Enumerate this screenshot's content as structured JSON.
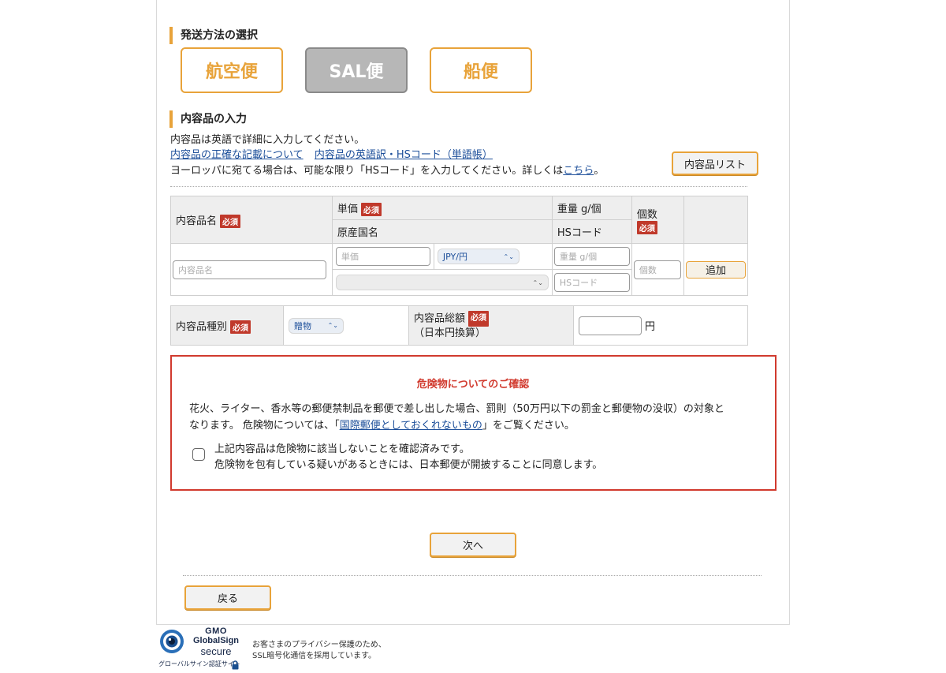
{
  "shipping": {
    "title": "発送方法の選択",
    "options": [
      {
        "label": "航空便",
        "state": "selectable"
      },
      {
        "label": "SAL便",
        "state": "disabled"
      },
      {
        "label": "船便",
        "state": "selectable"
      }
    ]
  },
  "contents": {
    "title": "内容品の入力",
    "intro": "内容品は英語で詳細に入力してください。",
    "link_accurate": "内容品の正確な記載について",
    "link_hs": "内容品の英語訳・HSコード（単語帳）",
    "europe_note": "ヨーロッパに宛てる場合は、可能な限り「HSコード」を入力してください。詳しくは",
    "europe_link": "こちら",
    "europe_end": "。",
    "list_button": "内容品リスト"
  },
  "table": {
    "required": "必須",
    "col_name": "内容品名",
    "col_price": "単価",
    "col_origin": "原産国名",
    "col_weight": "重量 g/個",
    "col_hs": "HSコード",
    "col_qty": "個数",
    "ph_name": "内容品名",
    "ph_price": "単価",
    "currency": "JPY/円",
    "ph_weight": "重量 g/個",
    "ph_hs": "HSコード",
    "ph_qty": "個数",
    "add_button": "追加"
  },
  "summary": {
    "type_label": "内容品種別",
    "type_value": "贈物",
    "total_label": "内容品総額",
    "total_sub": "（日本円換算）",
    "yen": "円"
  },
  "warning": {
    "title": "危険物についてのご確認",
    "line1": "花火、ライター、香水等の郵便禁制品を郵便で差し出した場合、罰則（50万円以下の罰金と郵便物の没収）の対象と",
    "line2_pre": "なります。 危険物については、「",
    "line2_link": "国際郵便としておくれないもの",
    "line2_post": "」をご覧ください。",
    "check1": "上記内容品は危険物に該当しないことを確認済みです。",
    "check2": "危険物を包有している疑いがあるときには、日本郵便が開披することに同意します。"
  },
  "nav": {
    "next": "次へ",
    "back": "戻る"
  },
  "footer": {
    "brand_top": "GMO",
    "brand_mid": "GlobalSign",
    "brand_bot": "secure",
    "brand_caption": "グローバルサイン認証サイト",
    "privacy1": "お客さまのプライバシー保護のため、",
    "privacy2": "SSL暗号化通信を採用しています。"
  },
  "colors": {
    "accent": "#e8a33a",
    "required": "#c0392b",
    "warning_border": "#d13a2e",
    "link": "#1d4f9a"
  }
}
